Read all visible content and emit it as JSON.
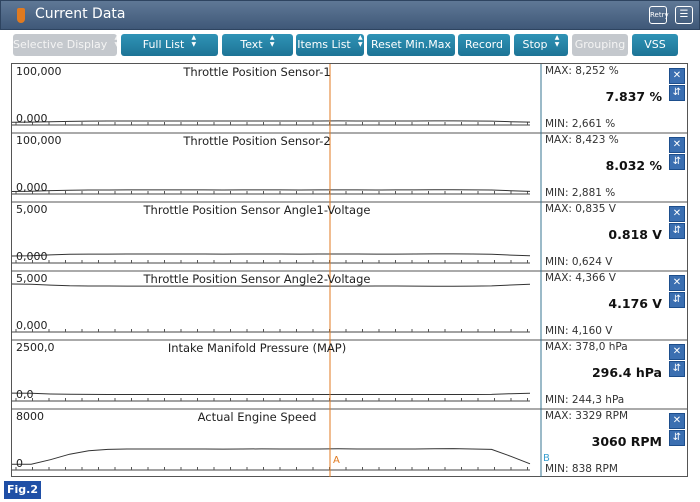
{
  "window": {
    "title": "Current Data",
    "retry_label": "Retry"
  },
  "toolbar": [
    {
      "label": "Selective Display",
      "enabled": false,
      "spinner": true
    },
    {
      "label": "Full List",
      "enabled": true,
      "spinner": true
    },
    {
      "label": "Text",
      "enabled": true,
      "spinner": true
    },
    {
      "label": "Items List",
      "enabled": true,
      "spinner": true
    },
    {
      "label": "Reset Min.Max",
      "enabled": true,
      "spinner": false
    },
    {
      "label": "Record",
      "enabled": true,
      "spinner": false
    },
    {
      "label": "Stop",
      "enabled": true,
      "spinner": true
    },
    {
      "label": "Grouping",
      "enabled": false,
      "spinner": false
    },
    {
      "label": "VSS",
      "enabled": true,
      "spinner": false
    }
  ],
  "cursors": {
    "a_label": "A",
    "b_label": "B",
    "a_color": "#e07a20",
    "b_color": "#3aa0d0"
  },
  "channels": [
    {
      "name": "Throttle Position Sensor-1",
      "ymax_label": "100,000",
      "ymin_label": "0,000",
      "ymax": 100,
      "ymin": 0,
      "max_label": "MAX: 8,252 %",
      "current_label": "7.837 %",
      "min_label": "MIN: 2,661 %",
      "trace": [
        5.0,
        5.2,
        6.0,
        6.6,
        7.0,
        7.2,
        7.2,
        7.3,
        7.3,
        7.3,
        7.3,
        7.2,
        7.3,
        7.3,
        7.3,
        7.2,
        7.3,
        7.4,
        7.3,
        7.2,
        7.2,
        7.3,
        7.5,
        7.5,
        7.3,
        7.1,
        6.0,
        5.2
      ]
    },
    {
      "name": "Throttle Position Sensor-2",
      "ymax_label": "100,000",
      "ymin_label": "0,000",
      "ymax": 100,
      "ymin": 0,
      "max_label": "MAX: 8,423 %",
      "current_label": "8.032 %",
      "min_label": "MIN: 2,881 %",
      "trace": [
        4.6,
        5.0,
        6.2,
        7.0,
        7.2,
        7.3,
        7.4,
        7.4,
        7.4,
        7.4,
        7.4,
        7.3,
        7.4,
        7.4,
        7.4,
        7.3,
        7.4,
        7.5,
        7.4,
        7.3,
        7.4,
        7.4,
        7.6,
        7.6,
        7.4,
        7.2,
        6.0,
        4.8
      ]
    },
    {
      "name": "Throttle Position Sensor Angle1-Voltage",
      "ymax_label": "5,000",
      "ymin_label": "0,000",
      "ymax": 5,
      "ymin": 0,
      "max_label": "MAX: 0,835 V",
      "current_label": "0.818 V",
      "min_label": "MIN: 0,624 V",
      "trace": [
        0.64,
        0.66,
        0.74,
        0.79,
        0.81,
        0.81,
        0.82,
        0.82,
        0.82,
        0.82,
        0.82,
        0.81,
        0.82,
        0.82,
        0.82,
        0.81,
        0.82,
        0.82,
        0.82,
        0.81,
        0.81,
        0.82,
        0.83,
        0.83,
        0.82,
        0.8,
        0.72,
        0.66
      ]
    },
    {
      "name": "Throttle Position Sensor Angle2-Voltage",
      "ymax_label": "5,000",
      "ymin_label": "0,000",
      "ymax": 5,
      "ymin": 0,
      "max_label": "MAX: 4,366 V",
      "current_label": "4.176 V",
      "min_label": "MIN: 4,160 V",
      "trace": [
        4.36,
        4.34,
        4.26,
        4.2,
        4.18,
        4.18,
        4.17,
        4.17,
        4.17,
        4.17,
        4.17,
        4.18,
        4.17,
        4.17,
        4.17,
        4.18,
        4.17,
        4.17,
        4.17,
        4.18,
        4.18,
        4.17,
        4.16,
        4.16,
        4.17,
        4.19,
        4.27,
        4.34
      ]
    },
    {
      "name": "Intake Manifold Pressure (MAP)",
      "ymax_label": "2500,0",
      "ymin_label": "0,0",
      "ymax": 2500,
      "ymin": 0,
      "max_label": "MAX: 378,0 hPa",
      "current_label": "296.4 hPa",
      "min_label": "MIN: 244,3 hPa",
      "trace": [
        360,
        350,
        320,
        305,
        298,
        296,
        295,
        296,
        296,
        296,
        296,
        297,
        296,
        296,
        296,
        297,
        296,
        295,
        296,
        297,
        297,
        296,
        294,
        294,
        296,
        300,
        330,
        355
      ]
    },
    {
      "name": "Actual Engine Speed",
      "ymax_label": "8000",
      "ymin_label": "0",
      "ymax": 8000,
      "ymin": 0,
      "max_label": "MAX:  3329 RPM",
      "current_label": "3060 RPM",
      "min_label": "MIN:  838 RPM",
      "trace": [
        840,
        850,
        1500,
        2300,
        2800,
        3000,
        3050,
        3050,
        3060,
        3060,
        3060,
        3040,
        3060,
        3070,
        3060,
        3050,
        3060,
        3080,
        3060,
        3050,
        3060,
        3060,
        3100,
        3120,
        3060,
        3000,
        2000,
        900
      ]
    }
  ],
  "figure_label": "Fig.2"
}
